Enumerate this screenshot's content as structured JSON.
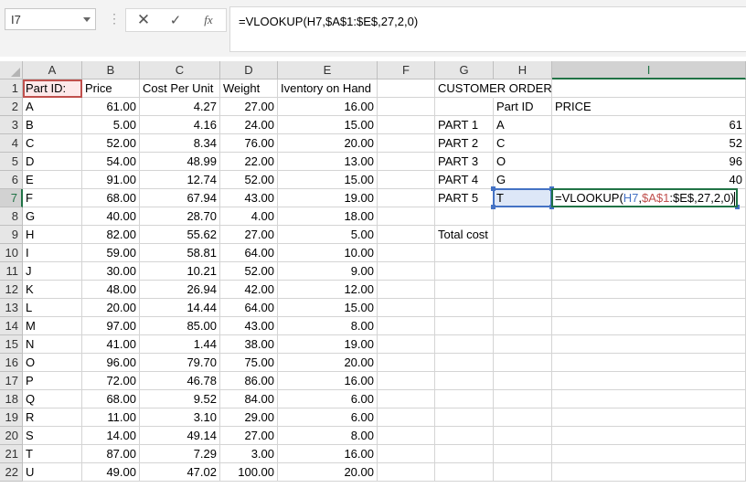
{
  "formula_bar": {
    "name_box": "I7",
    "formula": "=VLOOKUP(H7,$A$1:$E$,27,2,0)",
    "cancel_icon": "✕",
    "enter_icon": "✓",
    "fx_label": "fx"
  },
  "columns": [
    "A",
    "B",
    "C",
    "D",
    "E",
    "F",
    "G",
    "H",
    "I"
  ],
  "rows": [
    "1",
    "2",
    "3",
    "4",
    "5",
    "6",
    "7",
    "8",
    "9",
    "10",
    "11",
    "12",
    "13",
    "14",
    "15",
    "16",
    "17",
    "18",
    "19",
    "20",
    "21",
    "22"
  ],
  "table": {
    "headers": [
      "Part ID:",
      "Price",
      "Cost Per Unit",
      "Weight",
      "Iventory on Hand"
    ],
    "rows": [
      [
        "A",
        "61.00",
        "4.27",
        "27.00",
        "16.00"
      ],
      [
        "B",
        "5.00",
        "4.16",
        "24.00",
        "15.00"
      ],
      [
        "C",
        "52.00",
        "8.34",
        "76.00",
        "20.00"
      ],
      [
        "D",
        "54.00",
        "48.99",
        "22.00",
        "13.00"
      ],
      [
        "E",
        "91.00",
        "12.74",
        "52.00",
        "15.00"
      ],
      [
        "F",
        "68.00",
        "67.94",
        "43.00",
        "19.00"
      ],
      [
        "G",
        "40.00",
        "28.70",
        "4.00",
        "18.00"
      ],
      [
        "H",
        "82.00",
        "55.62",
        "27.00",
        "5.00"
      ],
      [
        "I",
        "59.00",
        "58.81",
        "64.00",
        "10.00"
      ],
      [
        "J",
        "30.00",
        "10.21",
        "52.00",
        "9.00"
      ],
      [
        "K",
        "48.00",
        "26.94",
        "42.00",
        "12.00"
      ],
      [
        "L",
        "20.00",
        "14.44",
        "64.00",
        "15.00"
      ],
      [
        "M",
        "97.00",
        "85.00",
        "43.00",
        "8.00"
      ],
      [
        "N",
        "41.00",
        "1.44",
        "38.00",
        "19.00"
      ],
      [
        "O",
        "96.00",
        "79.70",
        "75.00",
        "20.00"
      ],
      [
        "P",
        "72.00",
        "46.78",
        "86.00",
        "16.00"
      ],
      [
        "Q",
        "68.00",
        "9.52",
        "84.00",
        "6.00"
      ],
      [
        "R",
        "11.00",
        "3.10",
        "29.00",
        "6.00"
      ],
      [
        "S",
        "14.00",
        "49.14",
        "27.00",
        "8.00"
      ],
      [
        "T",
        "87.00",
        "7.29",
        "3.00",
        "16.00"
      ],
      [
        "U",
        "49.00",
        "47.02",
        "100.00",
        "20.00"
      ]
    ]
  },
  "order": {
    "title": "CUSTOMER ORDER",
    "part_id_header": "Part ID",
    "price_header": "PRICE",
    "items": [
      {
        "part": "PART 1",
        "id": "A",
        "price": "61"
      },
      {
        "part": "PART 2",
        "id": "C",
        "price": "52"
      },
      {
        "part": "PART 3",
        "id": "O",
        "price": "96"
      },
      {
        "part": "PART 4",
        "id": "G",
        "price": "40"
      },
      {
        "part": "PART 5",
        "id": "T",
        "price": ""
      }
    ],
    "total_label": "Total cost"
  },
  "editing": {
    "prefix": "=VLOOKUP(",
    "ref1": "H7",
    "comma1": ",",
    "ref2": "$A$1",
    "suffix": ":$E$,27,2,0)"
  }
}
